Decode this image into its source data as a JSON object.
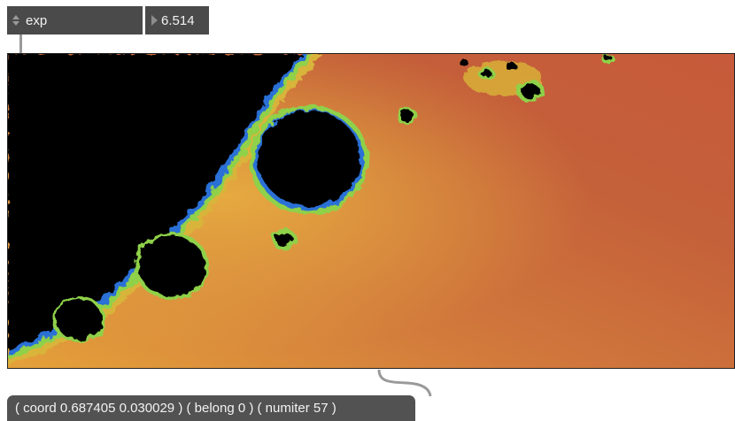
{
  "menu": {
    "selected": "exp"
  },
  "number_box": {
    "value": "6.514"
  },
  "message_box": {
    "text": "( coord 0.687405 0.030029 ) ( belong 0 ) ( numiter 57 )"
  },
  "colors": {
    "panel": "#4a4a4a",
    "fractal_inside": "#000000",
    "background_far": "#c65a3a",
    "background_near": "#df9a3a",
    "edge_green": "#8fd14a",
    "edge_blue": "#2a6fd6"
  }
}
